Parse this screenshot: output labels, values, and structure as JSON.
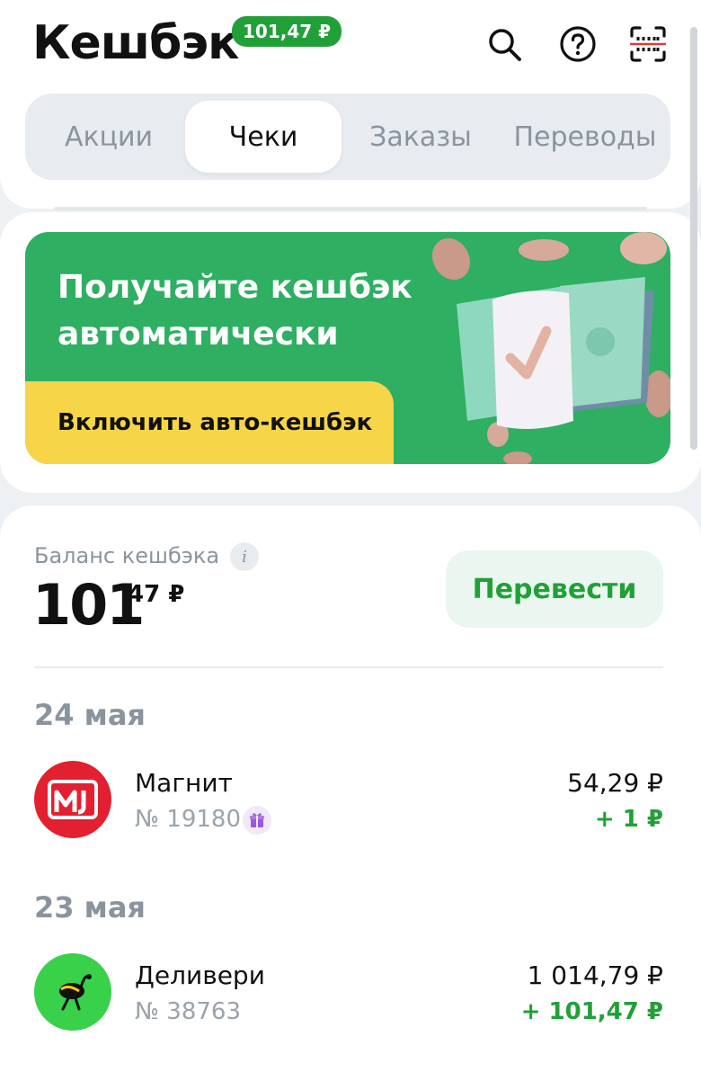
{
  "header": {
    "title": "Кешбэк",
    "badge": "101,47 ₽",
    "icons": [
      "search-icon",
      "help-icon",
      "scan-icon"
    ]
  },
  "tabs": [
    {
      "label": "Акции",
      "active": false
    },
    {
      "label": "Чеки",
      "active": true
    },
    {
      "label": "Заказы",
      "active": false
    },
    {
      "label": "Переводы",
      "active": false
    }
  ],
  "promo": {
    "title": "Получайте кешбэк автоматически",
    "button_label": "Включить авто-кешбэк"
  },
  "balance": {
    "label": "Баланс кешбэка",
    "info_icon": "i",
    "integer": "101",
    "fraction": "47 ₽",
    "transfer_label": "Перевести"
  },
  "transactions": [
    {
      "date": "24 мая",
      "store": "Магнит",
      "receipt": "№ 19180",
      "amount": "54,29 ₽",
      "cashback": "+ 1 ₽",
      "logo_color": "#e3202f",
      "has_gift": true
    },
    {
      "date": "23 мая",
      "store": "Деливери",
      "receipt": "№ 38763",
      "amount": "1 014,79 ₽",
      "cashback": "+ 101,47 ₽",
      "logo_color": "#39d04a",
      "has_gift": false
    }
  ],
  "colors": {
    "accent_green": "#21a038",
    "promo_green": "#2eaf62",
    "promo_yellow": "#f6d548"
  }
}
